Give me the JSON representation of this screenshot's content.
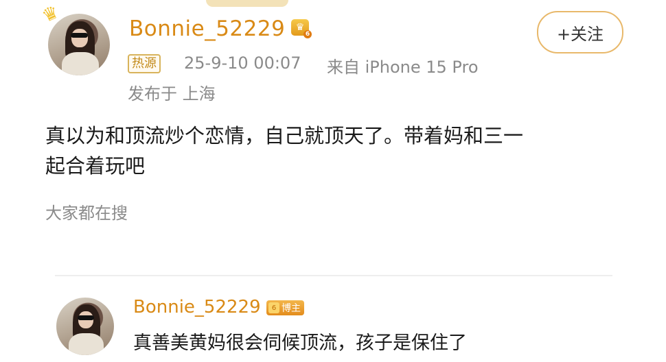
{
  "post": {
    "username": "Bonnie_52229",
    "vip_level": "6",
    "follow_label": "+关注",
    "hot_tag": "热源",
    "timestamp": "25-9-10 00:07",
    "source": "来自 iPhone 15 Pro",
    "location": "发布于 上海",
    "text_line1": "真以为和顶流炒个恋情，自己就顶天了。带着妈和三一",
    "text_line2": "起合着玩吧",
    "search_hint": "大家都在搜"
  },
  "reply": {
    "username": "Bonnie_52229",
    "vip_level": "6",
    "blogger_label": "博主",
    "text": "真善美黄妈很会伺候顶流，孩子是保住了"
  },
  "colors": {
    "username": "#d98a16",
    "accent_border": "#e8b86a",
    "meta_gray": "#8a8a8a"
  },
  "icons": {
    "crown": "crown-icon",
    "vip": "vip-badge-icon",
    "plus": "plus-icon"
  }
}
